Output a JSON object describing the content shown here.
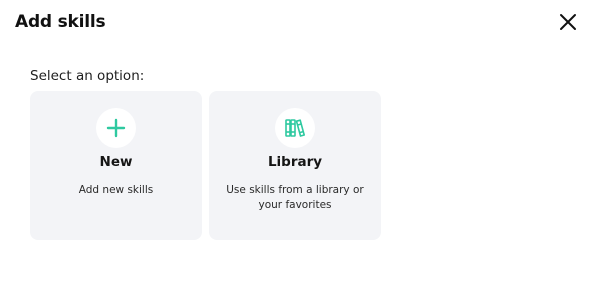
{
  "dialog": {
    "title": "Add skills",
    "close_icon": "close-icon",
    "prompt": "Select an option:"
  },
  "options": [
    {
      "icon": "plus-icon",
      "title": "New",
      "description": "Add new skills"
    },
    {
      "icon": "library-books-icon",
      "title": "Library",
      "description": "Use skills from a library or your favorites"
    }
  ],
  "colors": {
    "accent": "#2ec9a0",
    "card_bg": "#f3f4f7",
    "text": "#111111"
  }
}
